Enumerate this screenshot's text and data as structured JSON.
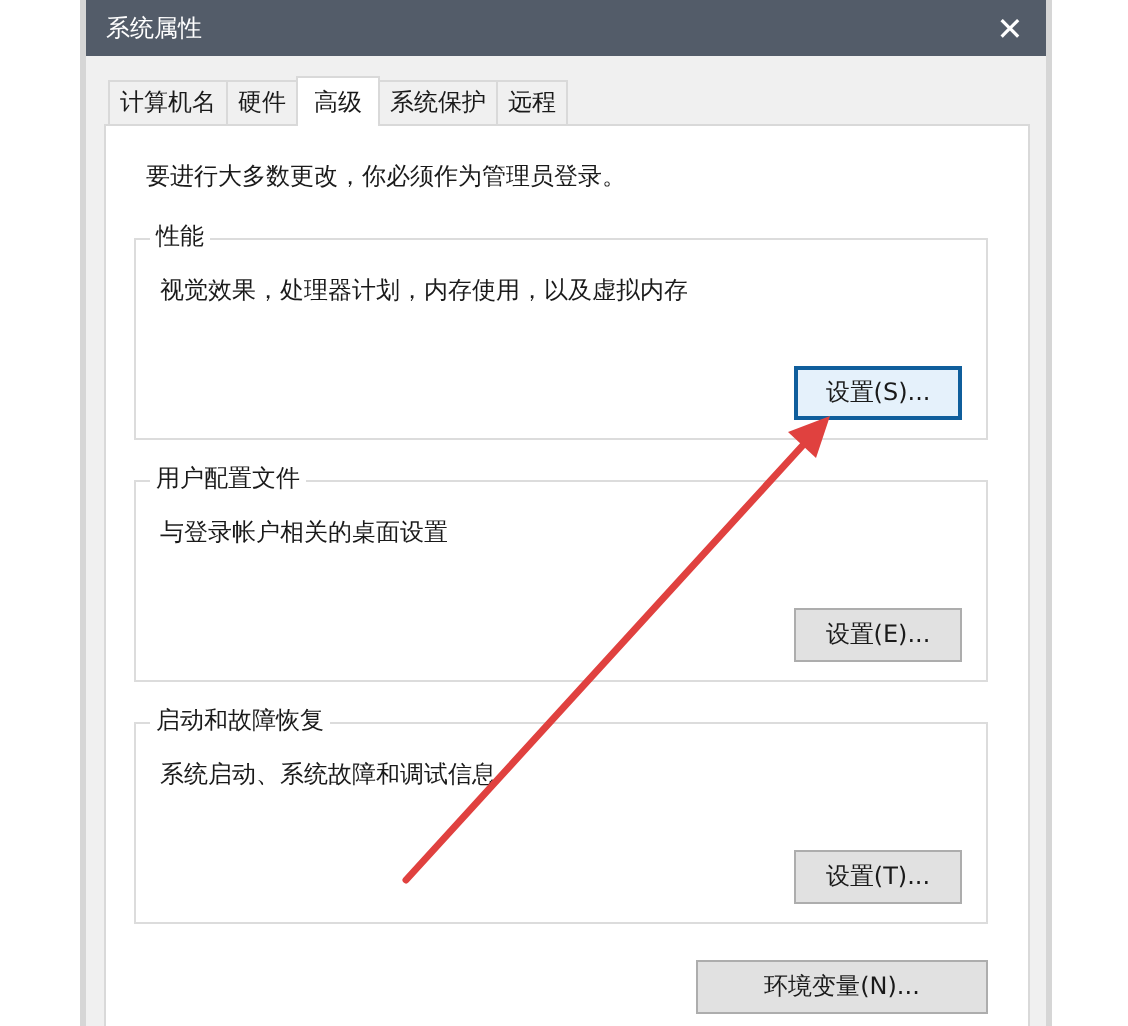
{
  "window": {
    "title": "系统属性",
    "close": "✕"
  },
  "tabs": [
    {
      "label": "计算机名",
      "selected": false
    },
    {
      "label": "硬件",
      "selected": false
    },
    {
      "label": "高级",
      "selected": true
    },
    {
      "label": "系统保护",
      "selected": false
    },
    {
      "label": "远程",
      "selected": false
    }
  ],
  "notice": "要进行大多数更改，你必须作为管理员登录。",
  "groups": [
    {
      "title": "性能",
      "description": "视觉效果，处理器计划，内存使用，以及虚拟内存",
      "button": {
        "label": "设置(S)...",
        "focused": true
      }
    },
    {
      "title": "用户配置文件",
      "description": "与登录帐户相关的桌面设置",
      "button": {
        "label": "设置(E)...",
        "focused": false
      }
    },
    {
      "title": "启动和故障恢复",
      "description": "系统启动、系统故障和调试信息",
      "button": {
        "label": "设置(T)...",
        "focused": false
      }
    }
  ],
  "env_button": {
    "label": "环境变量(N)...",
    "focused": false
  },
  "annotation": {
    "kind": "arrow"
  }
}
